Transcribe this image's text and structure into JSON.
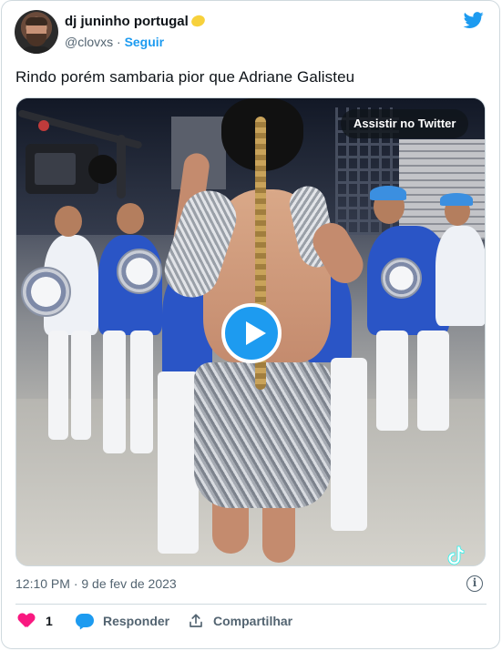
{
  "author": {
    "display_name": "dj juninho portugal",
    "handle": "@clovxs",
    "separator": "·",
    "follow_label": "Seguir"
  },
  "tweet": {
    "text": "Rindo porém sambaria pior que Adriane Galisteu",
    "timestamp": "12:10 PM · 9 de fev de 2023"
  },
  "media": {
    "watch_label": "Assistir no Twitter",
    "type": "video"
  },
  "actions": {
    "like_count": "1",
    "reply_label": "Responder",
    "share_label": "Compartilhar"
  },
  "colors": {
    "accent": "#1d9bf0",
    "like": "#f91880",
    "muted": "#536471",
    "text": "#0f1419"
  },
  "icons": {
    "brand": "twitter-bird-icon",
    "name_emoji": "lemon-icon",
    "info": "info-icon",
    "like": "heart-icon",
    "reply": "reply-bubble-icon",
    "share": "share-icon",
    "play": "play-icon",
    "watermark": "tiktok-logo-icon"
  }
}
